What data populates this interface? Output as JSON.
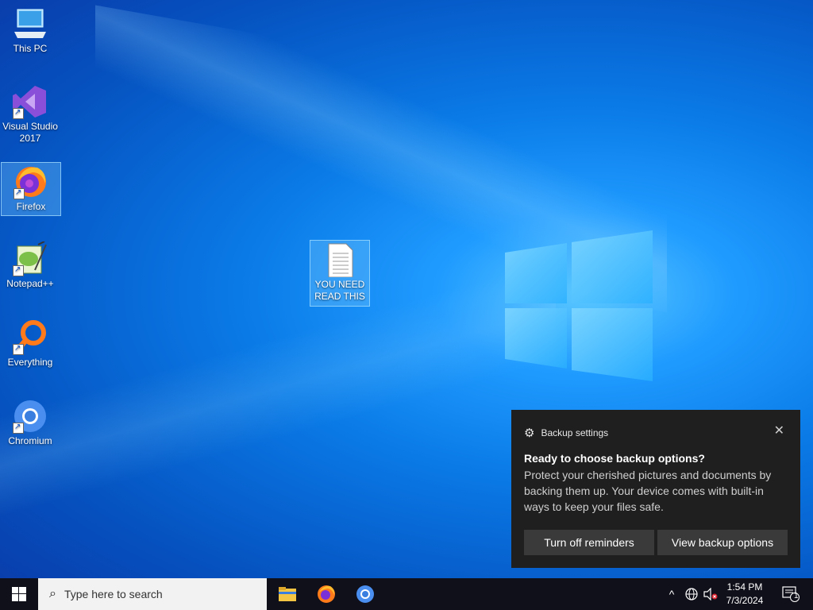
{
  "desktop": {
    "icons": [
      {
        "label": "This PC"
      },
      {
        "label": "Visual Studio 2017"
      },
      {
        "label": "Firefox"
      },
      {
        "label": "Notepad++"
      },
      {
        "label": "Everything"
      },
      {
        "label": "Chromium"
      },
      {
        "label": "YOU NEED READ THIS"
      }
    ]
  },
  "toast": {
    "app_name": "Backup settings",
    "title": "Ready to choose backup options?",
    "body": "Protect your cherished pictures and documents by backing them up. Your device comes with built-in ways to keep your files safe.",
    "close_glyph": "✕",
    "buttons": [
      "Turn off reminders",
      "View backup options"
    ]
  },
  "taskbar": {
    "search_placeholder": "Type here to search",
    "time": "1:54 PM",
    "date": "7/3/2024",
    "notification_count": "1"
  },
  "colors": {
    "desktop_accent": "#0a7ae6",
    "taskbar_bg": "#10101a",
    "toast_bg": "#1f1f1f",
    "toast_button_bg": "#3a3a3a"
  }
}
